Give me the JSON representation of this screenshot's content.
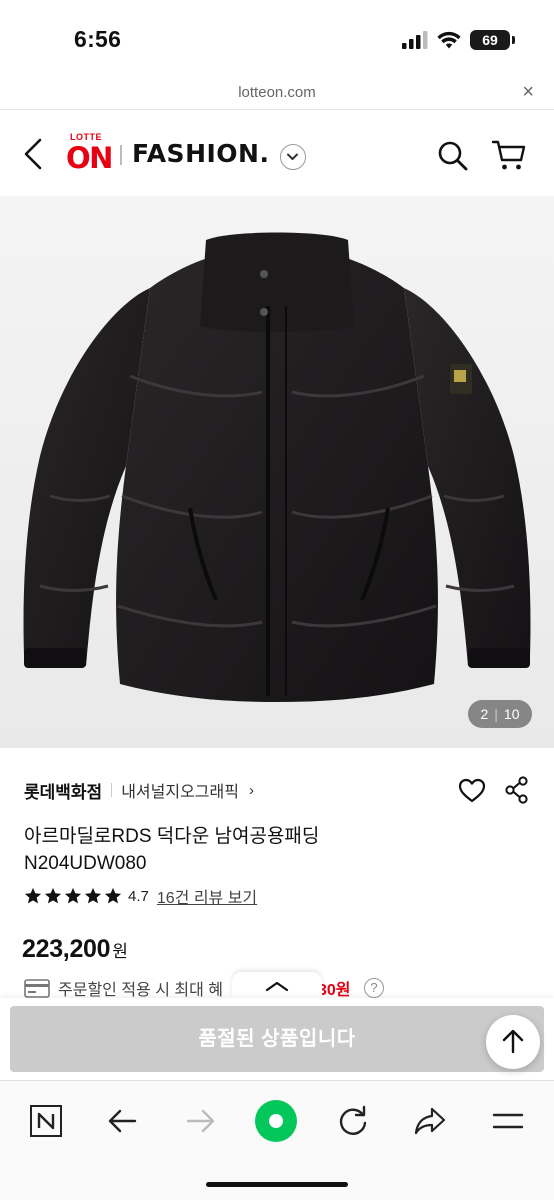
{
  "status_bar": {
    "time": "6:56",
    "battery": "69"
  },
  "url_bar": {
    "url": "lotteon.com",
    "close_label": "×"
  },
  "header": {
    "logo_top": "LOTTE",
    "logo_main": "ON",
    "section_title": "FASHION."
  },
  "gallery": {
    "current": "2",
    "total": "10"
  },
  "product": {
    "brand": "롯데백화점",
    "seller": "내셔널지오그래픽",
    "seller_chevron": "›",
    "title_line1": "아르마딜로RDS 덕다운 남여공용패딩",
    "title_line2": "N204UDW080",
    "rating": 4.7,
    "rating_text": "4.7",
    "stars_filled": 5,
    "review_link": "16건 리뷰 보기",
    "price": "223,200",
    "price_unit": "원",
    "discount_text": "주문할인 적용 시 최대 혜",
    "discount_amount": "30원",
    "help_label": "?"
  },
  "soldout": {
    "label": "품절된 상품입니다"
  },
  "colors": {
    "brand_red": "#e60012",
    "naver_green": "#03c75a",
    "soldout_gray": "#cbcbcb"
  },
  "toolbar_icons": [
    "naver-n-icon",
    "back-arrow-icon",
    "forward-arrow-icon",
    "green-dot-icon",
    "refresh-icon",
    "share-icon",
    "menu-icon"
  ]
}
